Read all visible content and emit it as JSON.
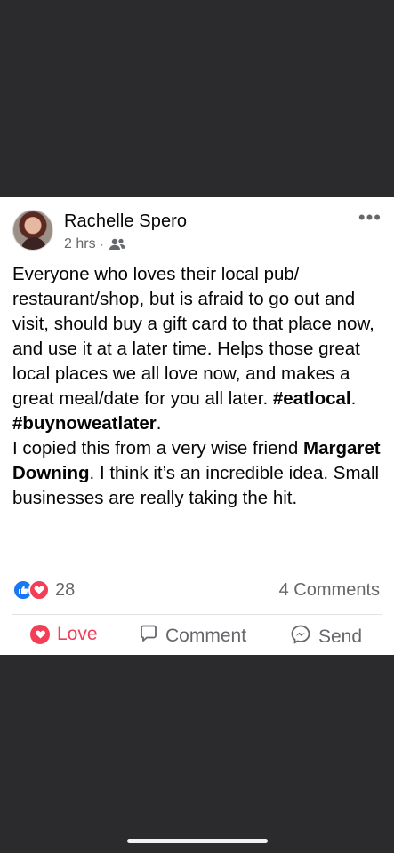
{
  "post": {
    "author": "Rachelle Spero",
    "time": "2 hrs",
    "separator": "·",
    "more": "•••",
    "text": {
      "p1": "Everyone who loves their local pub/ restaurant/shop, but is afraid to go out and visit, should buy a gift card to that place now, and use it at a later time. Helps those great local places we all love now, and makes a great meal/date for you all later. ",
      "tag1": "#eatlocal",
      "dot": ".",
      "tag2": "#buynoweatlater",
      "dot2": ".",
      "p2": "I copied this from a very wise friend ",
      "mention": "Margaret Downing",
      "p3": ". I think it’s an incredible idea.  Small businesses are really taking the hit."
    },
    "reactions_count": "28",
    "comments_count": "4 Comments"
  },
  "actions": {
    "love": "Love",
    "comment": "Comment",
    "send": "Send"
  },
  "colors": {
    "accent_love": "#f33e58",
    "accent_like": "#1877f2",
    "muted": "#65676b",
    "background_dark": "#2b2b2d"
  },
  "icons": [
    "friends-icon",
    "more-options-icon",
    "like-reaction-icon",
    "love-reaction-icon",
    "heart-icon",
    "comment-icon",
    "messenger-icon"
  ]
}
